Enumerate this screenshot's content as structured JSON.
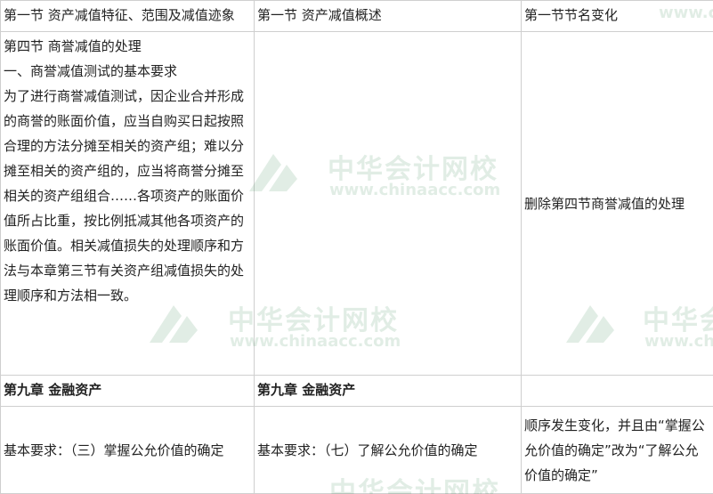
{
  "table": {
    "header": [
      "第一节 资产减值特征、范围及减值迹象",
      "第一节 资产减值概述",
      "第一节节名变化"
    ],
    "row1": {
      "col1": [
        "第四节 商誉减值的处理",
        "一、商誉减值测试的基本要求",
        "为了进行商誉减值测试，因企业合并形成的商誉的账面价值，应当自购买日起按照合理的方法分摊至相关的资产组；难以分摊至相关的资产组的，应当将商誉分摊至相关的资产组组合……各项资产的账面价值所占比重，按比例抵减其他各项资产的账面价值。相关减值损失的处理顺序和方法与本章第三节有关资产组减值损失的处理顺序和方法相一致。"
      ],
      "col2": "",
      "col3": "删除第四节商誉减值的处理"
    },
    "row2": {
      "col1": "第九章 金融资产",
      "col2": "第九章 金融资产",
      "col3": ""
    },
    "row3": {
      "col1": "基本要求：（三）掌握公允价值的确定",
      "col2": "基本要求：（七）了解公允价值的确定",
      "col3": "顺序发生变化，并且由“掌握公允价值的确定”改为“了解公允价值的确定”"
    }
  },
  "watermark": {
    "name_cn": "中华会计网校",
    "url": "www.chinaacc.com",
    "color": "#1f7a3c"
  }
}
